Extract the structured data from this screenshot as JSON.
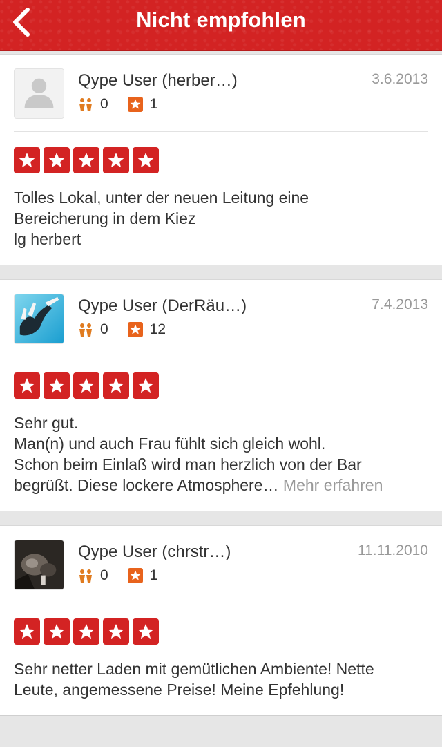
{
  "header": {
    "title": "Nicht empfohlen"
  },
  "reviews": [
    {
      "user_name": "Qype User (herber…)",
      "friends": "0",
      "reviews": "1",
      "date": "3.6.2013",
      "avatar": "default-avatar",
      "rating": 5,
      "text": "Tolles Lokal, unter der neuen Leitung eine\nBereicherung in dem Kiez\nlg herbert",
      "more": ""
    },
    {
      "user_name": "Qype User (DerRäu…)",
      "friends": "0",
      "reviews": "12",
      "date": "7.4.2013",
      "avatar": "photo-avatar-blue",
      "rating": 5,
      "text": "Sehr gut.\nMan(n) und auch Frau fühlt sich gleich wohl.\nSchon beim Einlaß wird man herzlich von der Bar\nbegrüßt. Diese lockere Atmosphere… ",
      "more": "Mehr erfahren"
    },
    {
      "user_name": "Qype User (chrstr…)",
      "friends": "0",
      "reviews": "1",
      "date": "11.11.2010",
      "avatar": "photo-avatar-dark",
      "rating": 5,
      "text": "Sehr netter Laden mit gemütlichen Ambiente! Nette\nLeute, angemessene Preise! Meine Epfehlung!",
      "more": ""
    }
  ],
  "colors": {
    "brand_red": "#d32323",
    "friends_icon": "#e07b1f",
    "review_badge": "#e8631c"
  }
}
